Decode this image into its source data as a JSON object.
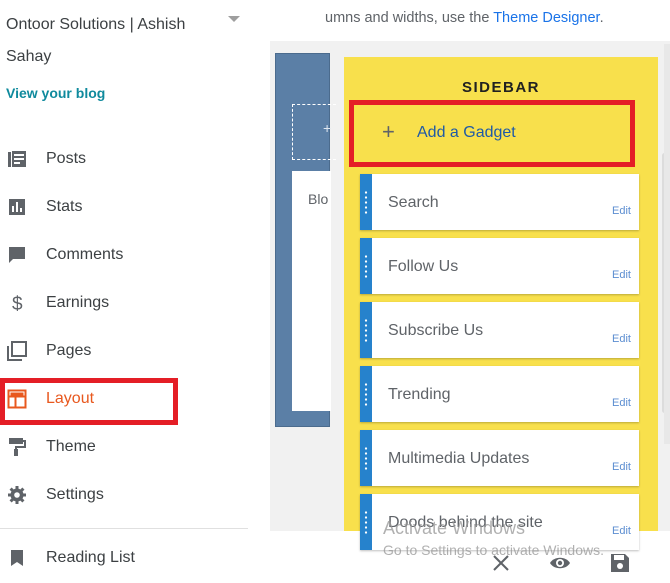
{
  "blog": {
    "title": "Ontoor Solutions | Ashish Sahay",
    "view_link": "View your blog"
  },
  "nav": {
    "items": [
      {
        "label": "Posts",
        "icon": "posts-icon"
      },
      {
        "label": "Stats",
        "icon": "stats-icon"
      },
      {
        "label": "Comments",
        "icon": "comments-icon"
      },
      {
        "label": "Earnings",
        "icon": "dollar-icon"
      },
      {
        "label": "Pages",
        "icon": "pages-icon"
      },
      {
        "label": "Layout",
        "icon": "layout-icon",
        "active": true
      },
      {
        "label": "Theme",
        "icon": "paint-roller-icon"
      },
      {
        "label": "Settings",
        "icon": "gear-icon"
      },
      {
        "label": "Reading List",
        "icon": "bookmark-icon"
      }
    ],
    "active_color": "#e8581e"
  },
  "notice": {
    "prefix": "umns and widths, use the ",
    "link": "Theme Designer",
    "suffix": "."
  },
  "layout_canvas": {
    "left_column_text": "Blo",
    "sidebar_title": "SIDEBAR",
    "add_gadget": "Add a Gadget",
    "gadgets": [
      {
        "name": "Search",
        "edit": "Edit"
      },
      {
        "name": "Follow Us",
        "edit": "Edit"
      },
      {
        "name": "Subscribe Us",
        "edit": "Edit"
      },
      {
        "name": "Trending",
        "edit": "Edit"
      },
      {
        "name": "Multimedia Updates",
        "edit": "Edit"
      },
      {
        "name": "Doods behind the site",
        "edit": "Edit"
      }
    ]
  },
  "watermark": {
    "line1": "Activate Windows",
    "line2": "Go to Settings to activate Windows."
  },
  "colors": {
    "highlight": "#e41e26",
    "sidebar_panel": "#f8e04c",
    "gadget_handle": "#2682cc",
    "left_column": "#5b7fa6",
    "link": "#1a73e8"
  }
}
